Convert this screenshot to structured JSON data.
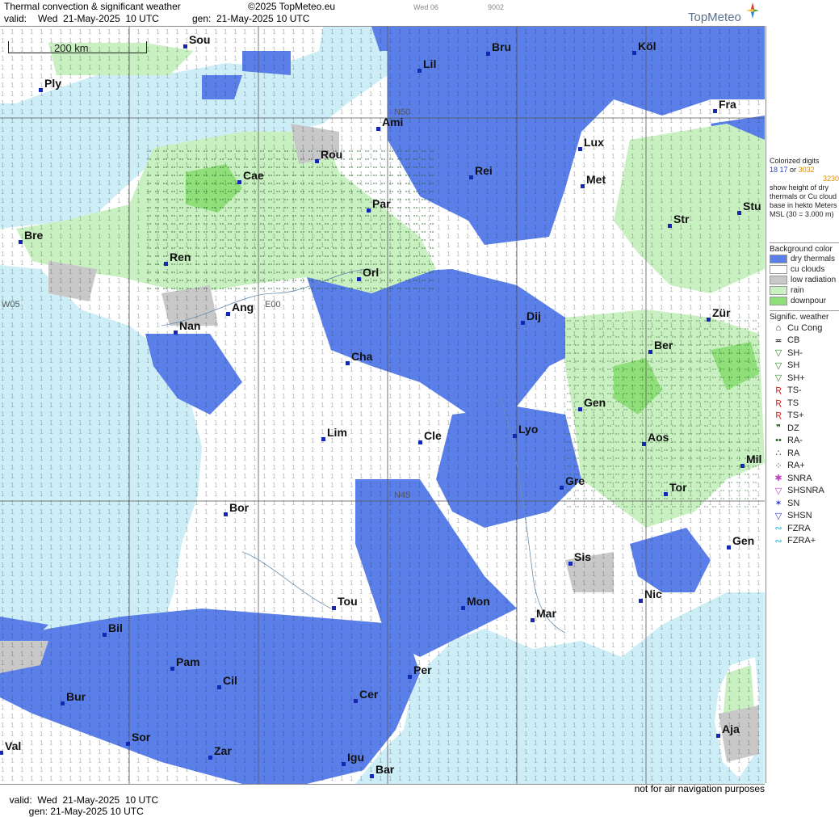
{
  "header": {
    "title": "Thermal convection & significant weather",
    "copyright": "©2025 TopMeteo.eu",
    "top_small_1": "Wed 06",
    "top_small_2": "9002",
    "valid_label": "valid:",
    "valid_value": "Wed  21-May-2025  10 UTC",
    "gen_label": "gen:",
    "gen_value": "21-May-2025 10 UTC",
    "brand": "TopMeteo"
  },
  "map": {
    "scale": "200 km",
    "grid_labels": [
      "W05",
      "E00",
      "N50",
      "N45"
    ],
    "cities": [
      "Ply",
      "Sou",
      "Lil",
      "Bru",
      "Köl",
      "Ami",
      "Fra",
      "Rou",
      "Lux",
      "Cae",
      "Rei",
      "Met",
      "Par",
      "Stu",
      "Bre",
      "Str",
      "Ren",
      "Orl",
      "Ang",
      "Dij",
      "Zür",
      "Nan",
      "Ber",
      "Cha",
      "Gen",
      "Lim",
      "Cle",
      "Lyo",
      "Aos",
      "Mil",
      "Gre",
      "Tor",
      "Bor",
      "Sis",
      "Gen",
      "Nic",
      "Mon",
      "Mar",
      "Tou",
      "Bil",
      "Pam",
      "Per",
      "Cil",
      "Bur",
      "Cer",
      "Sor",
      "Aja",
      "Val",
      "Zar",
      "Igu",
      "Bar"
    ]
  },
  "legend": {
    "colorized_title": "Colorized digits",
    "examples": [
      "18 17",
      "or",
      "3032",
      "3230"
    ],
    "desc": "show height of dry thermals or Cu cloud base in hekto Meters MSL (30 = 3.000 m)",
    "bg_title": "Background color",
    "bg_items": [
      {
        "label": "dry thermals",
        "color": "#5b7fe8"
      },
      {
        "label": "cu clouds",
        "color": "#ffffff"
      },
      {
        "label": "low radiation",
        "color": "#c8c8c8"
      },
      {
        "label": "rain",
        "color": "#c9f0c0"
      },
      {
        "label": "downpour",
        "color": "#8fe07a"
      }
    ],
    "wx_title": "Signific. weather",
    "wx_items": [
      {
        "sym": "⌂",
        "label": "Cu Cong",
        "color": "#222"
      },
      {
        "sym": "≖",
        "label": "CB",
        "color": "#222"
      },
      {
        "sym": "▽",
        "label": "SH-",
        "color": "#2b8a2b"
      },
      {
        "sym": "▽",
        "label": "SH",
        "color": "#2b8a2b"
      },
      {
        "sym": "▽",
        "label": "SH+",
        "color": "#2b8a2b"
      },
      {
        "sym": "Ʀ",
        "label": "TS-",
        "color": "#d21d1d"
      },
      {
        "sym": "Ʀ",
        "label": "TS",
        "color": "#d21d1d"
      },
      {
        "sym": "Ʀ",
        "label": "TS+",
        "color": "#d21d1d"
      },
      {
        "sym": "❞",
        "label": "DZ",
        "color": "#1d5d1d"
      },
      {
        "sym": "••",
        "label": "RA-",
        "color": "#1d5d1d"
      },
      {
        "sym": "∴",
        "label": "RA",
        "color": "#1d5d1d"
      },
      {
        "sym": "⁘",
        "label": "RA+",
        "color": "#1d5d1d"
      },
      {
        "sym": "✱",
        "label": "SNRA",
        "color": "#c040c0"
      },
      {
        "sym": "▽",
        "label": "SHSNRA",
        "color": "#c040c0"
      },
      {
        "sym": "✶",
        "label": "SN",
        "color": "#2a3fd0"
      },
      {
        "sym": "▽",
        "label": "SHSN",
        "color": "#2a3fd0"
      },
      {
        "sym": "∾",
        "label": "FZRA",
        "color": "#1db6e0"
      },
      {
        "sym": "∾",
        "label": "FZRA+",
        "color": "#1db6e0"
      }
    ]
  },
  "footer": {
    "valid": "valid:  Wed  21-May-2025  10 UTC",
    "gen": "gen: 21-May-2025 10 UTC",
    "note": "not for air navigation purposes"
  },
  "colors": {
    "sea": "#cdeef6",
    "land_white": "#ffffff",
    "dry": "#5b7fe8",
    "rain": "#c9f0c0",
    "downpour": "#8fe07a",
    "low_rad": "#c8c8c8"
  }
}
